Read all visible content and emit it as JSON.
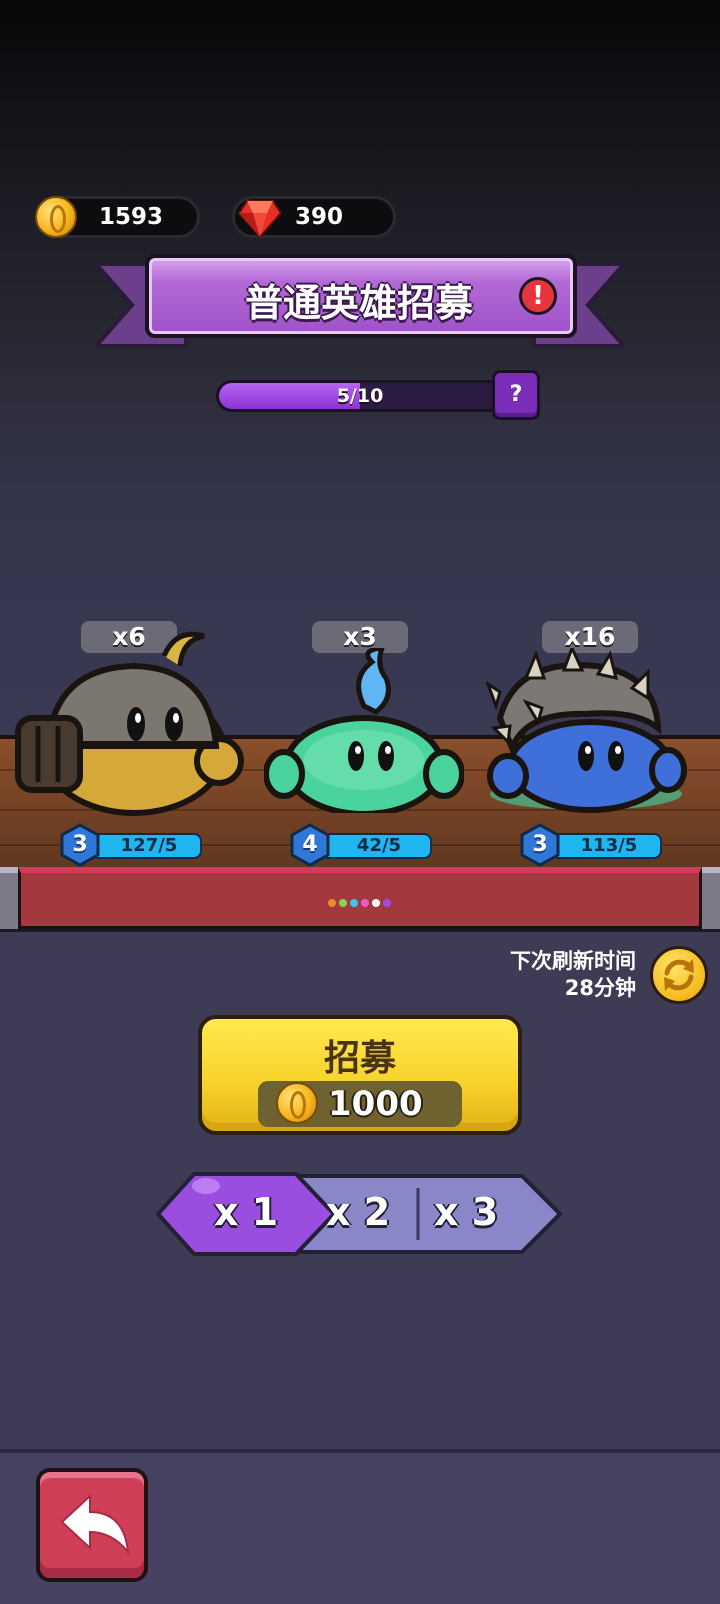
{
  "resources": {
    "gold": "1593",
    "gems": "390"
  },
  "banner": {
    "title": "普通英雄招募",
    "alert": "!"
  },
  "progress": {
    "text": "5/10",
    "fraction": 0.5,
    "help": "?"
  },
  "heroes": [
    {
      "count": "x6",
      "level": "3",
      "shards": "127/5"
    },
    {
      "count": "x3",
      "level": "4",
      "shards": "42/5"
    },
    {
      "count": "x16",
      "level": "3",
      "shards": "113/5"
    }
  ],
  "refresh": {
    "line1": "下次刷新时间",
    "line2": "28分钟"
  },
  "recruit": {
    "label": "招募",
    "cost": "1000"
  },
  "multipliers": {
    "options": [
      "x 1",
      "x 2",
      "x 3"
    ],
    "selected": "x 1"
  },
  "colors": {
    "accent_purple": "#9f52c9",
    "recruit_yellow": "#f7d12a",
    "level_blue": "#1fb6ef",
    "back_red": "#cf4058"
  }
}
